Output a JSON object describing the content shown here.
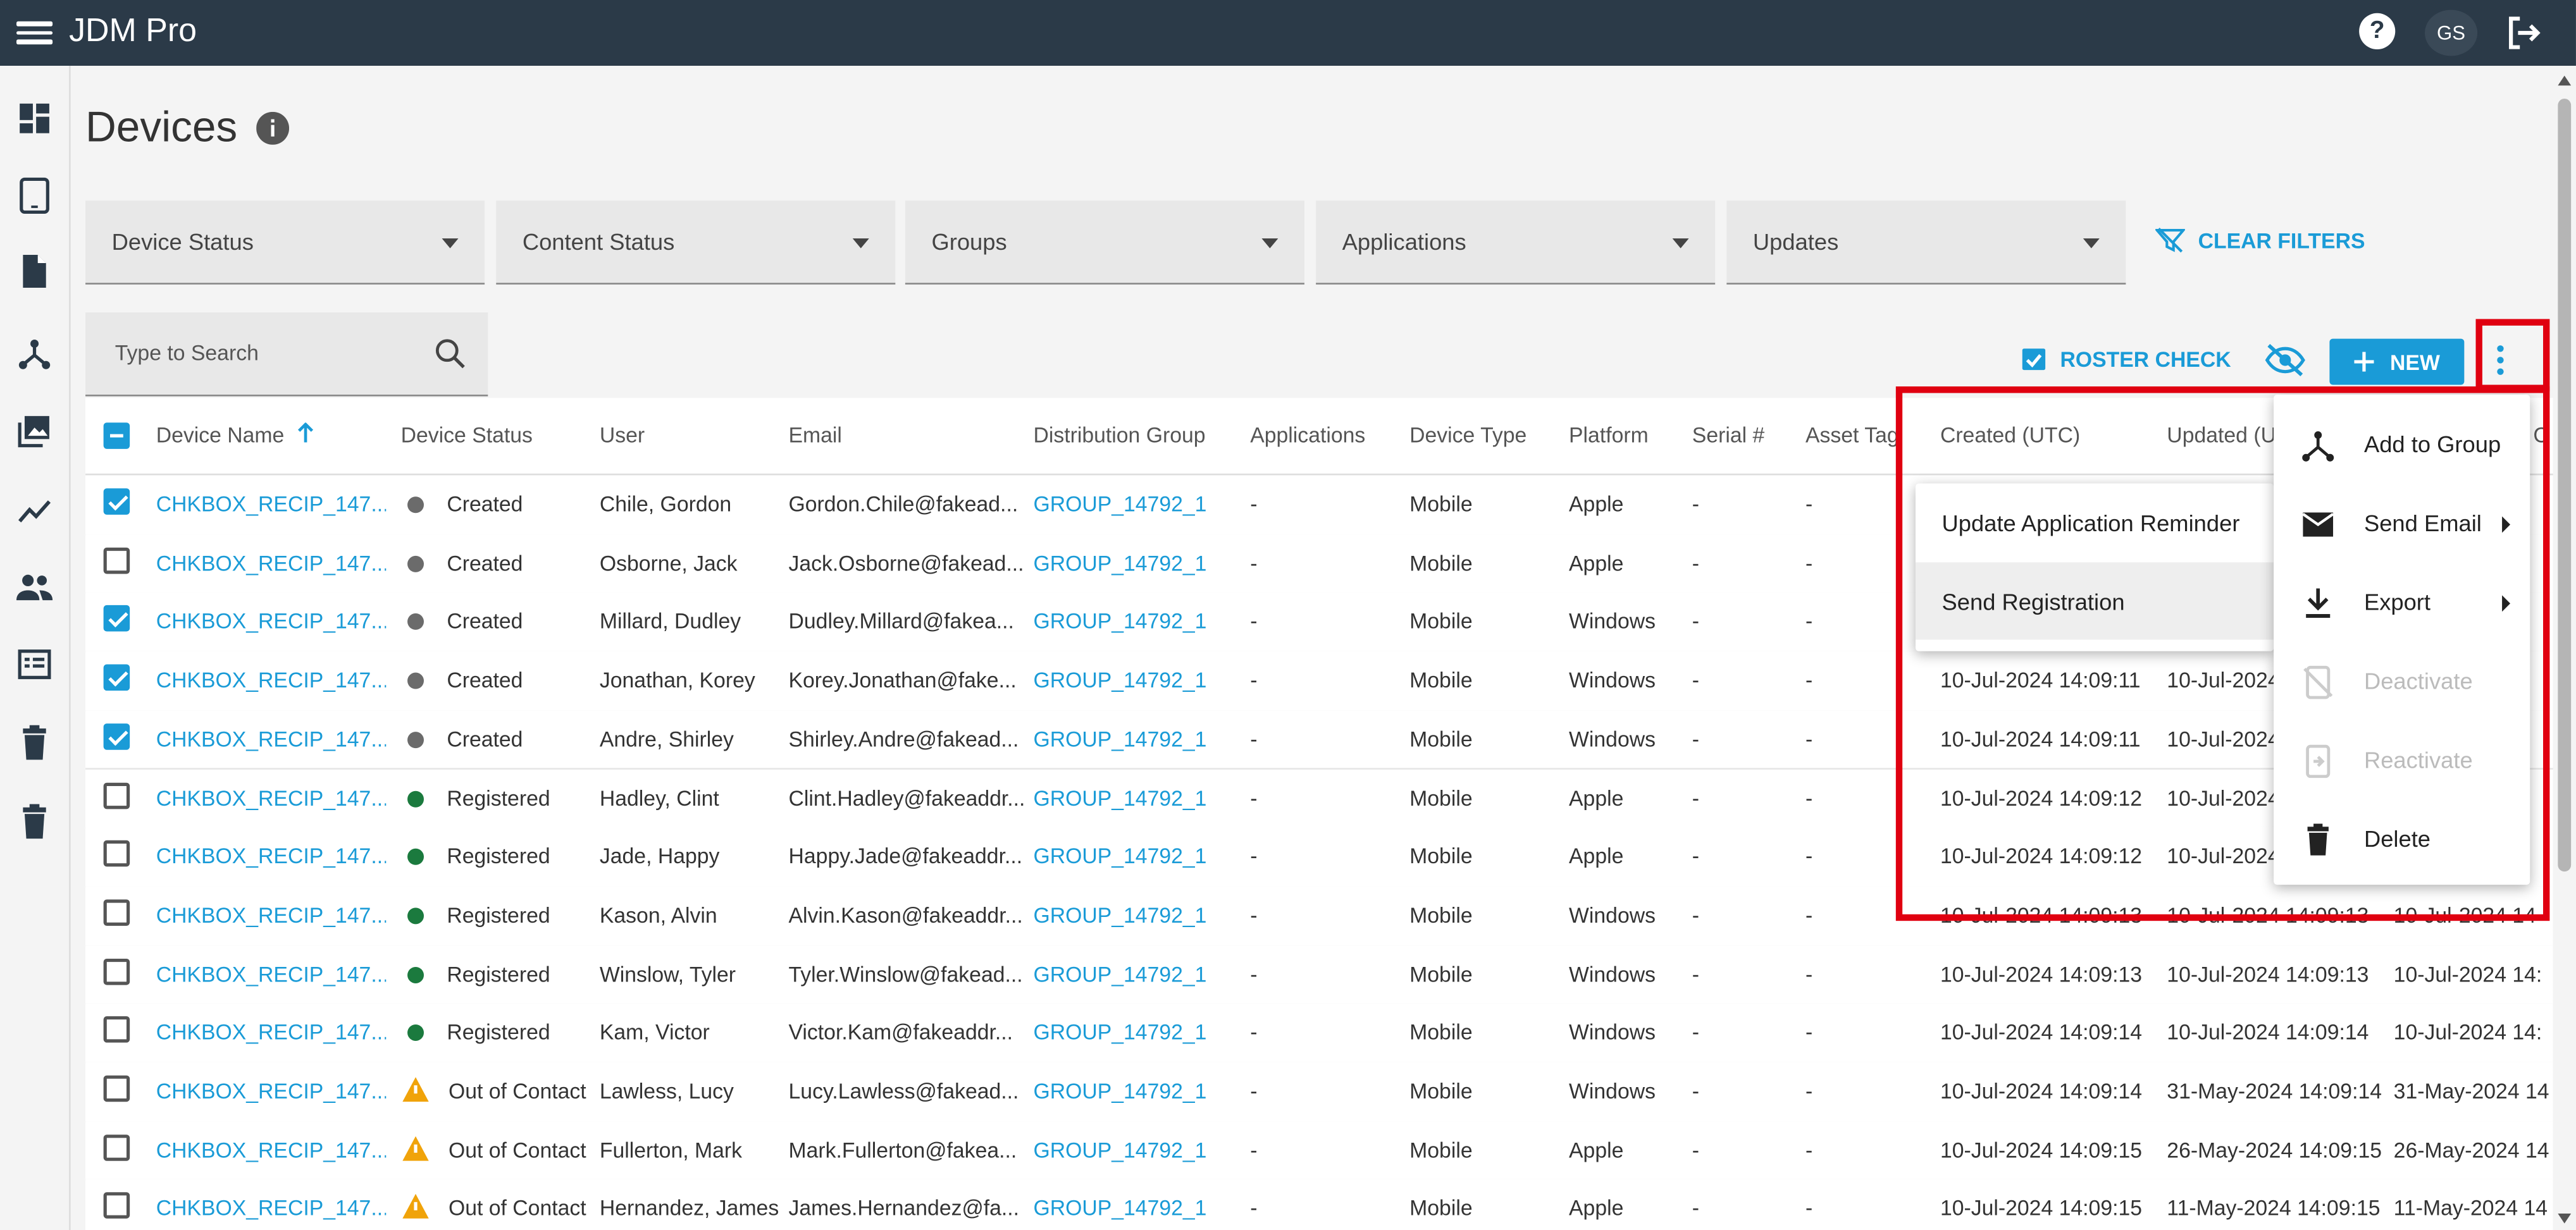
{
  "app": {
    "name": "JDM Pro",
    "help": "?",
    "user_initials": "GS"
  },
  "page": {
    "title": "Devices"
  },
  "filters": [
    {
      "label": "Device Status"
    },
    {
      "label": "Content Status"
    },
    {
      "label": "Groups"
    },
    {
      "label": "Applications"
    },
    {
      "label": "Updates"
    }
  ],
  "clear_filters": "CLEAR FILTERS",
  "search": {
    "placeholder": "Type to Search"
  },
  "toolbar": {
    "roster_check": "ROSTER CHECK",
    "new": "NEW"
  },
  "table": {
    "headers": {
      "device_name": "Device Name",
      "device_status": "Device Status",
      "user": "User",
      "email": "Email",
      "distribution_group": "Distribution Group",
      "applications": "Applications",
      "device_type": "Device Type",
      "platform": "Platform",
      "serial": "Serial #",
      "asset_tag": "Asset Tag",
      "created": "Created (UTC)",
      "updated": "Updated (U",
      "last": "C"
    },
    "rows": [
      {
        "checked": true,
        "name": "CHKBOX_RECIP_147...",
        "status": "Created",
        "status_color": "#6b6b6b",
        "user": "Chile, Gordon",
        "email": "Gordon.Chile@fakead...",
        "group": "GROUP_14792_1",
        "apps": "-",
        "type": "Mobile",
        "platform": "Apple",
        "serial": "-",
        "asset": "-",
        "created": "",
        "updated": "",
        "last": ""
      },
      {
        "checked": false,
        "name": "CHKBOX_RECIP_147...",
        "status": "Created",
        "status_color": "#6b6b6b",
        "user": "Osborne, Jack",
        "email": "Jack.Osborne@fakead...",
        "group": "GROUP_14792_1",
        "apps": "-",
        "type": "Mobile",
        "platform": "Apple",
        "serial": "-",
        "asset": "-",
        "created": "",
        "updated": "",
        "last": ""
      },
      {
        "checked": true,
        "name": "CHKBOX_RECIP_147...",
        "status": "Created",
        "status_color": "#6b6b6b",
        "user": "Millard, Dudley",
        "email": "Dudley.Millard@fakea...",
        "group": "GROUP_14792_1",
        "apps": "-",
        "type": "Mobile",
        "platform": "Windows",
        "serial": "-",
        "asset": "-",
        "created": "",
        "updated": "",
        "last": ""
      },
      {
        "checked": true,
        "name": "CHKBOX_RECIP_147...",
        "status": "Created",
        "status_color": "#6b6b6b",
        "user": "Jonathan, Korey",
        "email": "Korey.Jonathan@fake...",
        "group": "GROUP_14792_1",
        "apps": "-",
        "type": "Mobile",
        "platform": "Windows",
        "serial": "-",
        "asset": "-",
        "created": "10-Jul-2024 14:09:11",
        "updated": "10-Jul-2024",
        "last": ""
      },
      {
        "checked": true,
        "name": "CHKBOX_RECIP_147...",
        "status": "Created",
        "status_color": "#6b6b6b",
        "user": "Andre, Shirley",
        "email": "Shirley.Andre@fakead...",
        "group": "GROUP_14792_1",
        "apps": "-",
        "type": "Mobile",
        "platform": "Windows",
        "serial": "-",
        "asset": "-",
        "created": "10-Jul-2024 14:09:11",
        "updated": "10-Jul-2024",
        "last": ""
      },
      {
        "checked": false,
        "name": "CHKBOX_RECIP_147...",
        "status": "Registered",
        "status_color": "#1b7a3e",
        "user": "Hadley, Clint",
        "email": "Clint.Hadley@fakeaddr...",
        "group": "GROUP_14792_1",
        "apps": "-",
        "type": "Mobile",
        "platform": "Apple",
        "serial": "-",
        "asset": "-",
        "created": "10-Jul-2024 14:09:12",
        "updated": "10-Jul-2024",
        "last": ""
      },
      {
        "checked": false,
        "name": "CHKBOX_RECIP_147...",
        "status": "Registered",
        "status_color": "#1b7a3e",
        "user": "Jade, Happy",
        "email": "Happy.Jade@fakeaddr...",
        "group": "GROUP_14792_1",
        "apps": "-",
        "type": "Mobile",
        "platform": "Apple",
        "serial": "-",
        "asset": "-",
        "created": "10-Jul-2024 14:09:12",
        "updated": "10-Jul-2024",
        "last": ""
      },
      {
        "checked": false,
        "name": "CHKBOX_RECIP_147...",
        "status": "Registered",
        "status_color": "#1b7a3e",
        "user": "Kason, Alvin",
        "email": "Alvin.Kason@fakeaddr...",
        "group": "GROUP_14792_1",
        "apps": "-",
        "type": "Mobile",
        "platform": "Windows",
        "serial": "-",
        "asset": "-",
        "created": "10-Jul-2024 14:09:13",
        "updated": "10-Jul-2024 14:09:13",
        "last": "10-Jul-2024 14"
      },
      {
        "checked": false,
        "name": "CHKBOX_RECIP_147...",
        "status": "Registered",
        "status_color": "#1b7a3e",
        "user": "Winslow, Tyler",
        "email": "Tyler.Winslow@fakead...",
        "group": "GROUP_14792_1",
        "apps": "-",
        "type": "Mobile",
        "platform": "Windows",
        "serial": "-",
        "asset": "-",
        "created": "10-Jul-2024 14:09:13",
        "updated": "10-Jul-2024 14:09:13",
        "last": "10-Jul-2024 14:"
      },
      {
        "checked": false,
        "name": "CHKBOX_RECIP_147...",
        "status": "Registered",
        "status_color": "#1b7a3e",
        "user": "Kam, Victor",
        "email": "Victor.Kam@fakeaddr...",
        "group": "GROUP_14792_1",
        "apps": "-",
        "type": "Mobile",
        "platform": "Windows",
        "serial": "-",
        "asset": "-",
        "created": "10-Jul-2024 14:09:14",
        "updated": "10-Jul-2024 14:09:14",
        "last": "10-Jul-2024 14:"
      },
      {
        "checked": false,
        "name": "CHKBOX_RECIP_147...",
        "status": "Out of Contact",
        "status_color": "#f0a30a",
        "user": "Lawless, Lucy",
        "email": "Lucy.Lawless@fakead...",
        "group": "GROUP_14792_1",
        "apps": "-",
        "type": "Mobile",
        "platform": "Windows",
        "serial": "-",
        "asset": "-",
        "created": "10-Jul-2024 14:09:14",
        "updated": "31-May-2024 14:09:14",
        "last": "31-May-2024 14"
      },
      {
        "checked": false,
        "name": "CHKBOX_RECIP_147...",
        "status": "Out of Contact",
        "status_color": "#f0a30a",
        "user": "Fullerton, Mark",
        "email": "Mark.Fullerton@fakea...",
        "group": "GROUP_14792_1",
        "apps": "-",
        "type": "Mobile",
        "platform": "Apple",
        "serial": "-",
        "asset": "-",
        "created": "10-Jul-2024 14:09:15",
        "updated": "26-May-2024 14:09:15",
        "last": "26-May-2024 14"
      },
      {
        "checked": false,
        "name": "CHKBOX_RECIP_147...",
        "status": "Out of Contact",
        "status_color": "#f0a30a",
        "user": "Hernandez, James",
        "email": "James.Hernandez@fa...",
        "group": "GROUP_14792_1",
        "apps": "-",
        "type": "Mobile",
        "platform": "Apple",
        "serial": "-",
        "asset": "-",
        "created": "10-Jul-2024 14:09:15",
        "updated": "11-May-2024 14:09:15",
        "last": "11-May-2024 14"
      }
    ]
  },
  "send_email_submenu": {
    "items": [
      "Update Application Reminder",
      "Send Registration"
    ]
  },
  "actions_menu": {
    "items": [
      {
        "label": "Add to Group",
        "icon": "group-icon",
        "enabled": true
      },
      {
        "label": "Send Email",
        "icon": "email-icon",
        "enabled": true
      },
      {
        "label": "Export",
        "icon": "download-icon",
        "enabled": true
      },
      {
        "label": "Deactivate",
        "icon": "deactivate-icon",
        "enabled": false
      },
      {
        "label": "Reactivate",
        "icon": "reactivate-icon",
        "enabled": false
      },
      {
        "label": "Delete",
        "icon": "trash-icon",
        "enabled": true
      }
    ]
  },
  "colors": {
    "topbar": "#2b3a48",
    "accent": "#1a9bd7",
    "highlight_box": "#e00010",
    "created": "#6b6b6b",
    "registered": "#1b7a3e",
    "out_of_contact": "#f0a30a"
  }
}
